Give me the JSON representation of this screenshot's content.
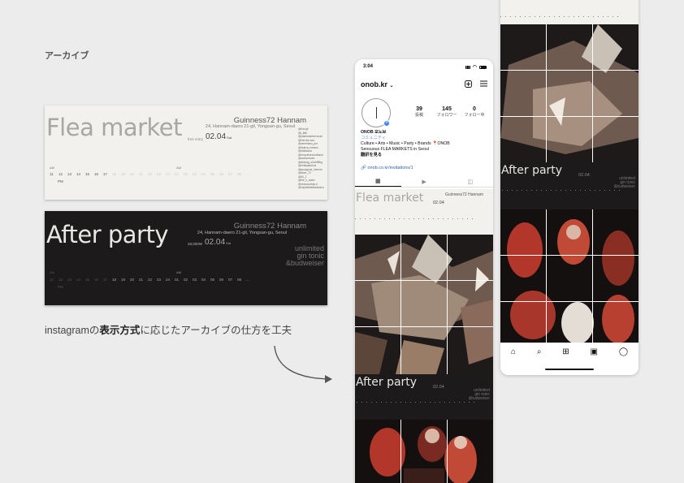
{
  "section_label": "アーカイブ",
  "flea_banner": {
    "title": "Flea market",
    "venue": "Guinness72 Hannam",
    "address": "24, Hannam-daero 21-gil, Yongsan-gu, Seoul",
    "entry": "free entry",
    "date": "02.04",
    "day": "Sat",
    "am_label": "AM",
    "pm_label": "PM",
    "brands": "@find.lyf\n@l_iiiiiii\n@plantsmarket.seoul\n@hitz.kim.sea\n@wemelano_pnr\n@deleca_mesmo\n@biblioteca\n@recyclesecondhand\n@aumoreaum\n@abcbag_s2k4l5ffkg\n@hhhkakaobus\n@groupplus_homme\n@atom_72\n@60_1\n@the_h_wash\n@newcountrys.d\n@inkythefabbofashion",
    "hours": [
      "11",
      "12",
      "13",
      "14",
      "15",
      "16",
      "17",
      "18",
      "19",
      "20",
      "21",
      "22",
      "23",
      "24",
      "01",
      "02",
      "03",
      "04",
      "05",
      "06",
      "07",
      "08",
      "..."
    ]
  },
  "after_banner": {
    "title": "After party",
    "venue": "Guinness72 Hannam",
    "address": "24, Hannam-daero 21-gil, Yongsan-gu, Seoul",
    "price": "28,000W",
    "date": "02.04",
    "day": "Sat",
    "am_label": "AM",
    "pm_label": "PM",
    "brands_line1": "unlimited",
    "brands_line2": "gin tonic",
    "brands_line3": "&budweiser",
    "hours": [
      "11",
      "12",
      "13",
      "14",
      "15",
      "16",
      "17",
      "18",
      "19",
      "20",
      "21",
      "22",
      "23",
      "24",
      "01",
      "02",
      "03",
      "04",
      "05",
      "06",
      "07",
      "08",
      "..."
    ]
  },
  "caption": {
    "before": "instagramの",
    "bold": "表示方式",
    "after": "に応じたアーカイブの仕方を工夫"
  },
  "phone": {
    "time": "3:04",
    "username": "onob.kr",
    "stats": [
      {
        "num": "39",
        "label": "投稿"
      },
      {
        "num": "145",
        "label": "フォロワー"
      },
      {
        "num": "0",
        "label": "フォロー中"
      }
    ],
    "bio_name": "ONOB 오노브",
    "bio_category": "コミュニティ",
    "bio_line1": "Culture • Arts • Music • Party • Brands 📍ONOB",
    "bio_line2": "Sensuous FLEA MARKETS in Seoul",
    "bio_translate": "翻訳を見る",
    "link": "onob.co.kr/invitations/1",
    "tile_flea_title": "Flea market",
    "tile_flea_venue": "Guinness72 Hannam",
    "tile_flea_date": "02.04",
    "tile_after_title": "After party",
    "tile_after_date": "02.04",
    "tile_after_u1": "unlimited",
    "tile_after_u2": "gin tonic",
    "tile_after_u3": "&budweiser"
  },
  "colors": {
    "accent": "#d8402f",
    "link": "#2c5eac"
  }
}
